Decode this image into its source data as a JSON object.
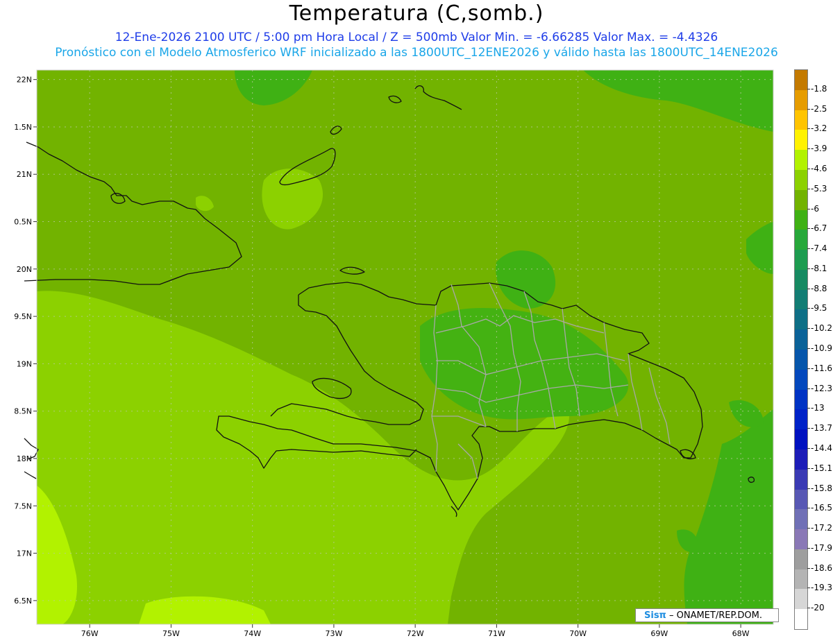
{
  "header": {
    "title": "Temperatura (C,somb.)",
    "subtitle1": "12-Ene-2026  2100 UTC / 5:00 pm Hora Local / Z = 500mb   Valor Min. = -6.66285  Valor Max. = -4.4326",
    "subtitle2": "Pronóstico con el Modelo Atmosferico WRF inicializado a las 1800UTC_12ENE2026 y válido hasta las  1800UTC_14ENE2026"
  },
  "map": {
    "lon_range": [
      -76.65,
      -67.6
    ],
    "lat_range": [
      16.25,
      22.1
    ],
    "lat_ticks": [
      {
        "value": 22,
        "label": "22N"
      },
      {
        "value": 21.5,
        "label": "1.5N"
      },
      {
        "value": 21,
        "label": "21N"
      },
      {
        "value": 20.5,
        "label": "0.5N"
      },
      {
        "value": 20,
        "label": "20N"
      },
      {
        "value": 19.5,
        "label": "9.5N"
      },
      {
        "value": 19,
        "label": "19N"
      },
      {
        "value": 18.5,
        "label": "8.5N"
      },
      {
        "value": 18,
        "label": "18N"
      },
      {
        "value": 17.5,
        "label": "7.5N"
      },
      {
        "value": 17,
        "label": "17N"
      },
      {
        "value": 16.5,
        "label": "6.5N"
      }
    ],
    "lon_ticks": [
      {
        "value": -76,
        "label": "76W"
      },
      {
        "value": -75,
        "label": "75W"
      },
      {
        "value": -74,
        "label": "74W"
      },
      {
        "value": -73,
        "label": "73W"
      },
      {
        "value": -72,
        "label": "72W"
      },
      {
        "value": -71,
        "label": "71W"
      },
      {
        "value": -70,
        "label": "70W"
      },
      {
        "value": -69,
        "label": "69W"
      },
      {
        "value": -68,
        "label": "68W"
      }
    ],
    "base_color": "#72b300",
    "field_colors": {
      "lighter": "#8cd100",
      "lightest": "#b2f200",
      "darker": "#3fb114"
    }
  },
  "colorbar": {
    "levels": [
      {
        "label": "-1.8",
        "color": "#c47a00"
      },
      {
        "label": "-2.5",
        "color": "#e69c00"
      },
      {
        "label": "-3.2",
        "color": "#ffc400"
      },
      {
        "label": "-3.9",
        "color": "#fff200"
      },
      {
        "label": "-4.6",
        "color": "#b2f200"
      },
      {
        "label": "-5.3",
        "color": "#8cd100"
      },
      {
        "label": "-6",
        "color": "#72b300"
      },
      {
        "label": "-6.7",
        "color": "#3fb114"
      },
      {
        "label": "-7.4",
        "color": "#27a83a"
      },
      {
        "label": "-8.1",
        "color": "#1d9c50"
      },
      {
        "label": "-8.8",
        "color": "#168a62"
      },
      {
        "label": "-9.5",
        "color": "#127d74"
      },
      {
        "label": "-10.2",
        "color": "#0e6f86"
      },
      {
        "label": "-10.9",
        "color": "#0a6298"
      },
      {
        "label": "-11.6",
        "color": "#0656ab"
      },
      {
        "label": "-12.3",
        "color": "#0348bd"
      },
      {
        "label": "-13",
        "color": "#0033c4"
      },
      {
        "label": "-13.7",
        "color": "#0022c8"
      },
      {
        "label": "-14.4",
        "color": "#0011c0"
      },
      {
        "label": "-15.1",
        "color": "#1d1db8"
      },
      {
        "label": "-15.8",
        "color": "#3a3ab4"
      },
      {
        "label": "-16.5",
        "color": "#5858b4"
      },
      {
        "label": "-17.2",
        "color": "#7070b6"
      },
      {
        "label": "-17.9",
        "color": "#8a78b6"
      },
      {
        "label": "-18.6",
        "color": "#9e9e9e"
      },
      {
        "label": "-19.3",
        "color": "#b4b4b4"
      },
      {
        "label": "-20",
        "color": "#d6d6d6"
      },
      {
        "label": "",
        "color": "#ffffff"
      }
    ]
  },
  "credit": {
    "logo": "Sisπ",
    "text": "– ONAMET/REP.DOM."
  }
}
